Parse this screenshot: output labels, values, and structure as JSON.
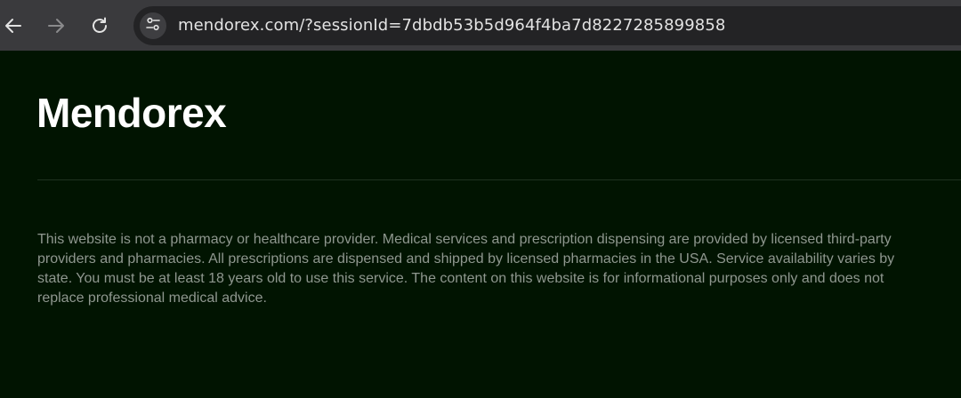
{
  "browser": {
    "url": "mendorex.com/?sessionId=7dbdb53b5d964f4ba7d8227285899858",
    "icons": {
      "back": "arrow-left-icon",
      "forward": "arrow-right-icon",
      "reload": "reload-icon",
      "site_settings": "tune-icon"
    },
    "colors": {
      "toolbar": "#3a3a3d",
      "omnibox": "#232325",
      "url_text": "#e3e3e3"
    }
  },
  "page": {
    "logo_text": "Mendorex",
    "disclaimer": "This website is not a pharmacy or healthcare provider. Medical services and prescription dispensing are provided by licensed third-party providers and pharmacies. All prescriptions are dispensed and shipped by licensed pharmacies in the USA. Service availability varies by state. You must be at least 18 years old to use this service. The content on this website is for informational purposes only and does not replace professional medical advice.",
    "colors": {
      "background": "#011401",
      "logo": "#ffffff",
      "disclaimer_text": "#8f978f",
      "divider": "#1f3220"
    }
  }
}
